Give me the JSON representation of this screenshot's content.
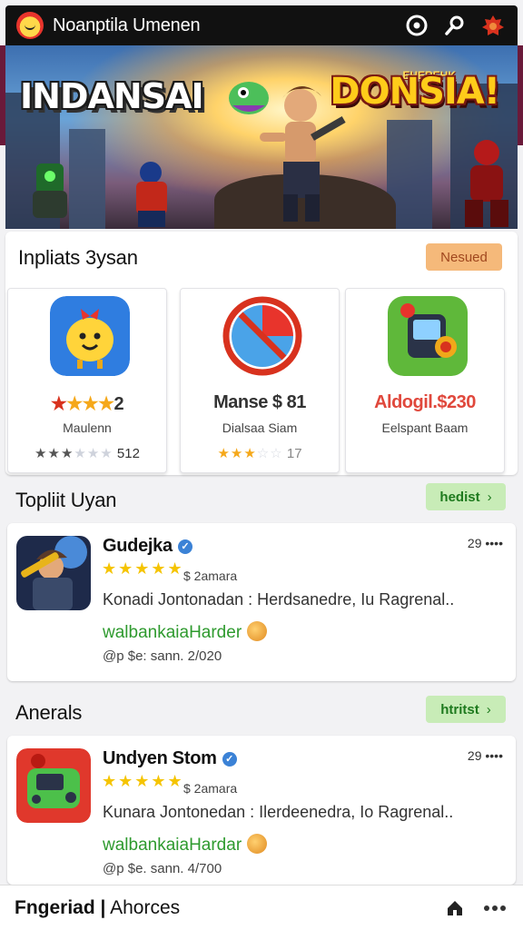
{
  "header": {
    "title": "Noanptila Umenen",
    "icons": [
      "app-logo-icon",
      "target-icon",
      "search-icon",
      "settings-badge-icon"
    ]
  },
  "hero": {
    "left_logo": "INDANSAI",
    "right_logo": "DONSIA!",
    "right_tag": "EHEREHK"
  },
  "featured": {
    "title": "Inpliats 3ysan",
    "badge": "Nesued",
    "items": [
      {
        "icon": "emoji-app-icon",
        "price": "★★★★2",
        "subtitle": "Maulenn",
        "rating": "512",
        "stars_filled": 3,
        "stars_total": 6
      },
      {
        "icon": "pie-chart-app-icon",
        "price": "Manse $ 81",
        "subtitle": "Dialsaa Siam",
        "rating": "17",
        "stars_filled": 3,
        "stars_total": 5
      },
      {
        "icon": "gamepad-app-icon",
        "price": "Aldogil.$230",
        "subtitle": "Eelspant Baam",
        "rating": "",
        "stars_filled": 0,
        "stars_total": 0
      }
    ]
  },
  "toplist": {
    "title": "Topliit Uyan",
    "button": "hedist",
    "app": {
      "name": "Gudejka",
      "stars": "★★★★★",
      "price": "$ 2amara",
      "description": "Konadi Jontonadan : Herdsanedre, Iu Ragrenal..",
      "developer": "walbankaiaHarder",
      "date": "@p $e: sann. 2/020",
      "count": "29 ••••"
    }
  },
  "anerals": {
    "title": "Anerals",
    "button": "htritst",
    "app": {
      "name": "Undyen Stom",
      "stars": "★★★★★",
      "price": "$ 2amara",
      "description": "Kunara Jontonedan : Ilerdeenedra, Io Ragrenal..",
      "developer": "walbankaiaHardar",
      "date": "@p $e. sann. 4/700",
      "count": "29 ••••"
    }
  },
  "bottombar": {
    "left": "Fngeriad",
    "separator": "|",
    "right": "Ahorces"
  },
  "colors": {
    "accent_green": "#2e9a2e",
    "badge_orange": "#f5b97a",
    "star_yellow": "#f5c400",
    "price_red": "#e0483c"
  }
}
